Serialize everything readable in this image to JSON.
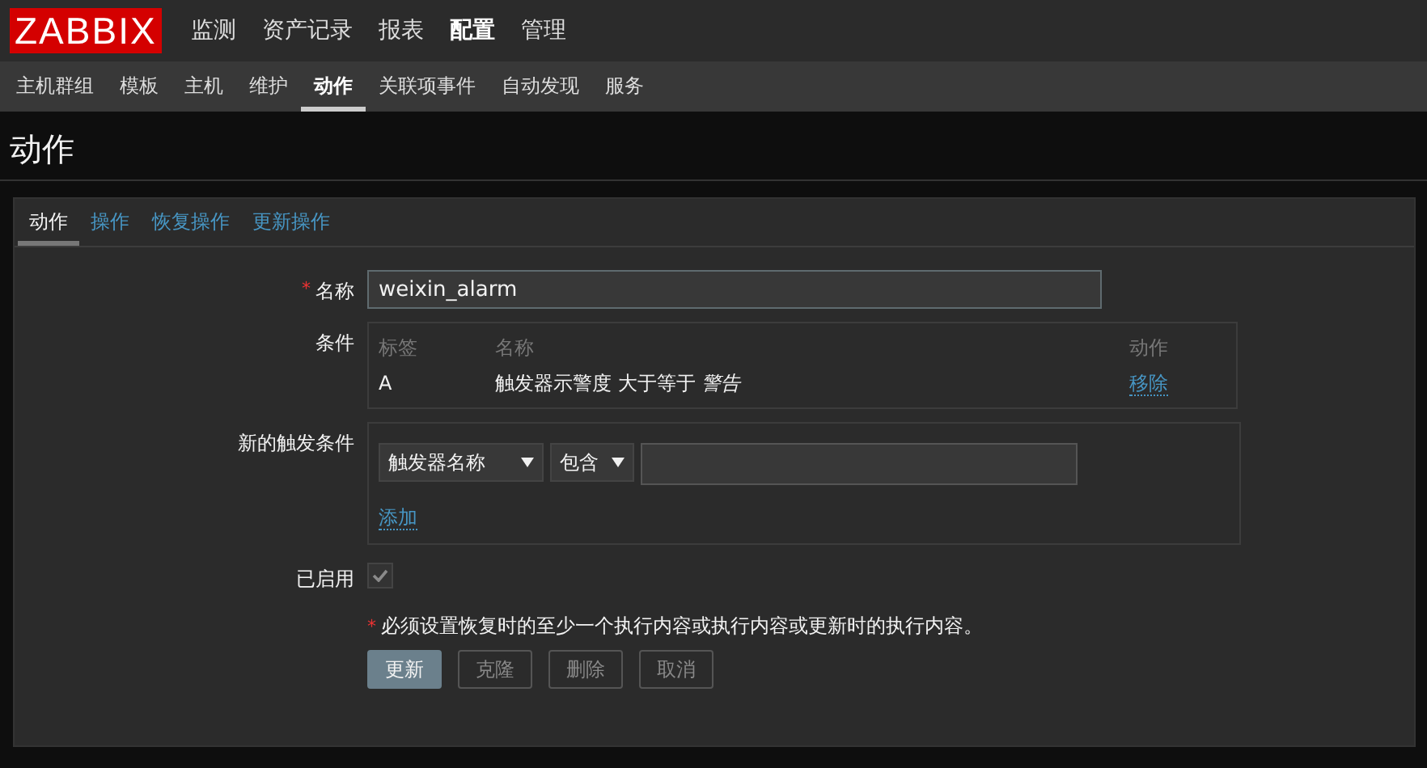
{
  "logo": "ZABBIX",
  "main_menu": [
    {
      "label": "监测",
      "selected": false
    },
    {
      "label": "资产记录",
      "selected": false
    },
    {
      "label": "报表",
      "selected": false
    },
    {
      "label": "配置",
      "selected": true
    },
    {
      "label": "管理",
      "selected": false
    }
  ],
  "sub_menu": [
    {
      "label": "主机群组",
      "selected": false
    },
    {
      "label": "模板",
      "selected": false
    },
    {
      "label": "主机",
      "selected": false
    },
    {
      "label": "维护",
      "selected": false
    },
    {
      "label": "动作",
      "selected": true
    },
    {
      "label": "关联项事件",
      "selected": false
    },
    {
      "label": "自动发现",
      "selected": false
    },
    {
      "label": "服务",
      "selected": false
    }
  ],
  "page_title": "动作",
  "tabs": [
    {
      "label": "动作",
      "selected": true
    },
    {
      "label": "操作",
      "selected": false
    },
    {
      "label": "恢复操作",
      "selected": false
    },
    {
      "label": "更新操作",
      "selected": false
    }
  ],
  "form": {
    "name": {
      "label": "名称",
      "required_mark": "*",
      "value": "weixin_alarm"
    },
    "conditions": {
      "label": "条件",
      "columns": [
        "标签",
        "名称",
        "动作"
      ],
      "rows": [
        {
          "tag": "A",
          "name": "触发器示警度 大于等于 *警告*",
          "action": "移除"
        }
      ]
    },
    "new_condition": {
      "label": "新的触发条件",
      "type_select": "触发器名称",
      "operator_select": "包含",
      "add_link": "添加"
    },
    "enabled": {
      "label": "已启用",
      "checked": true
    },
    "note_mark": "*",
    "note": "必须设置恢复时的至少一个执行内容或执行内容或更新时的执行内容。",
    "buttons": [
      {
        "label": "更新",
        "kind": "primary"
      },
      {
        "label": "克隆",
        "kind": "secondary"
      },
      {
        "label": "删除",
        "kind": "secondary"
      },
      {
        "label": "取消",
        "kind": "secondary"
      }
    ]
  }
}
